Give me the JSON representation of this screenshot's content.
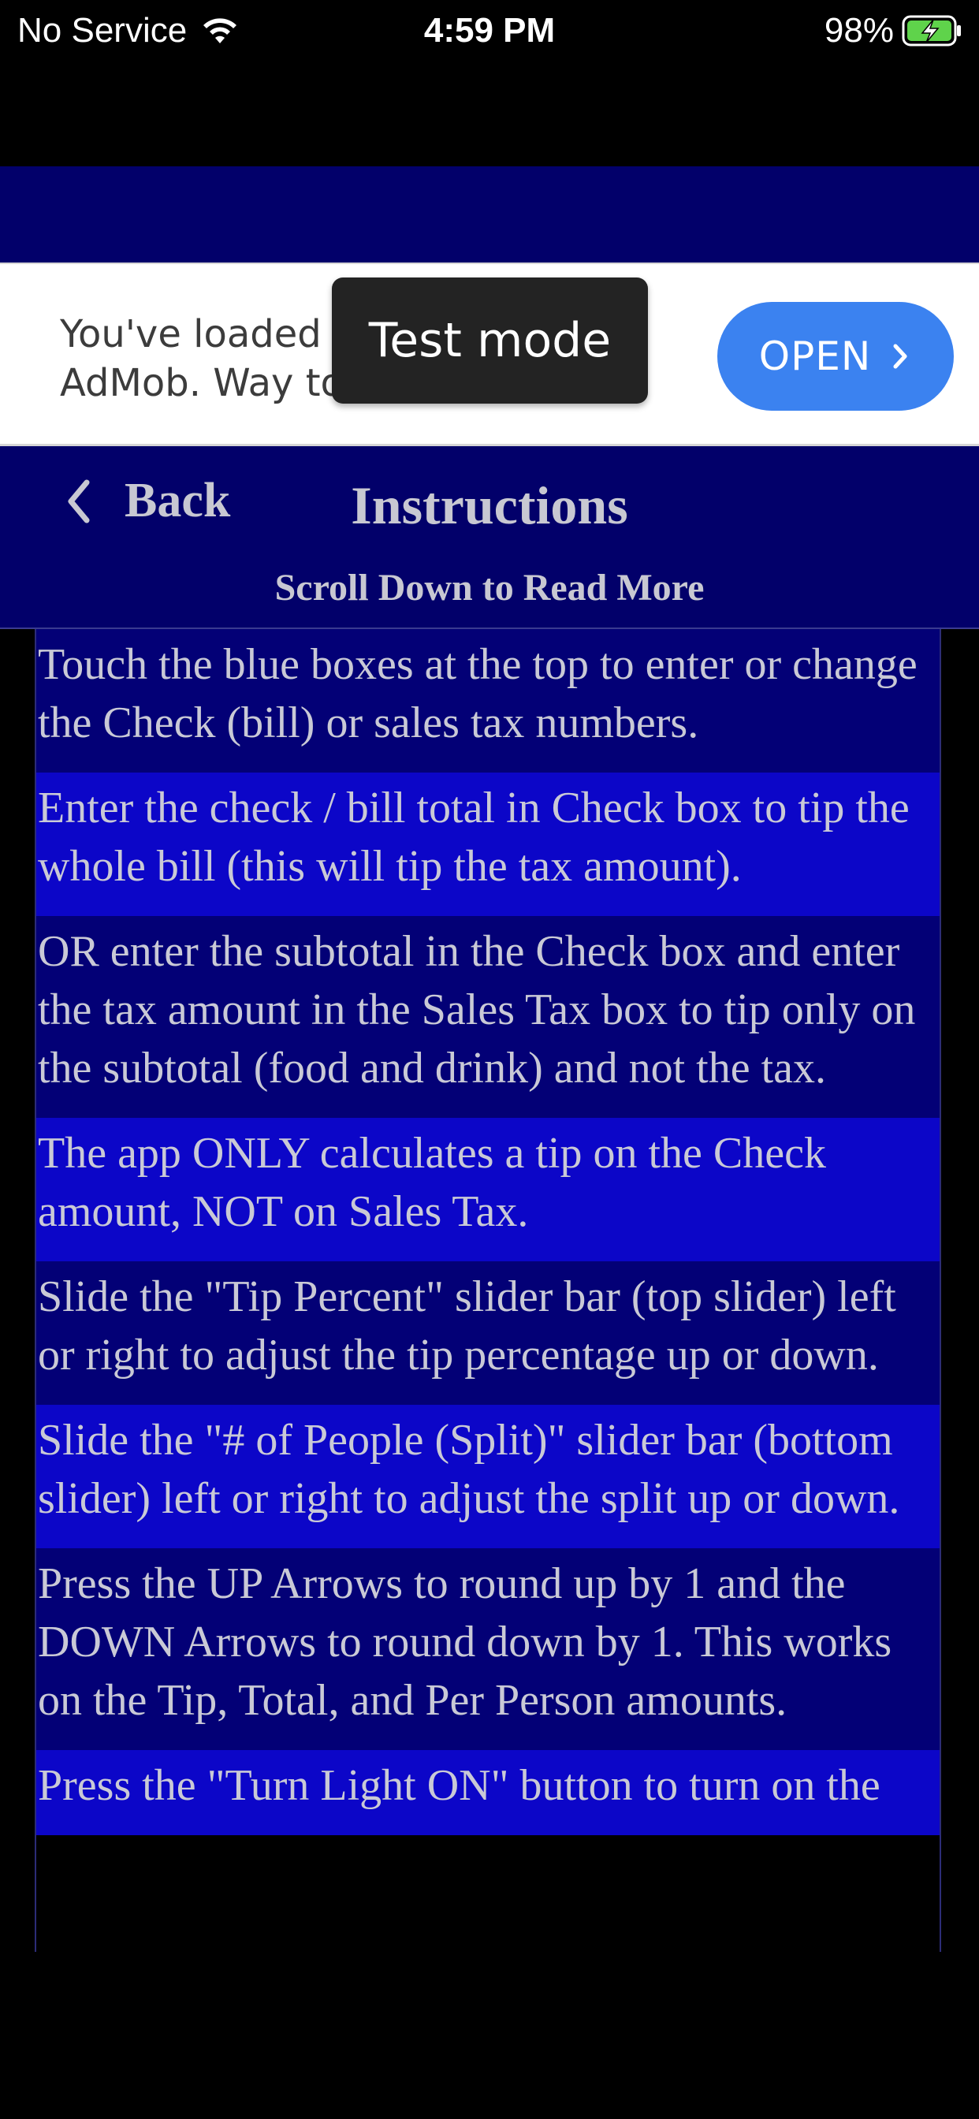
{
  "status_bar": {
    "carrier": "No Service",
    "time": "4:59 PM",
    "battery": "98%"
  },
  "ad": {
    "text_line1": "You've loaded a",
    "text_line2": "AdMob. Way to g",
    "open_label": "OPEN",
    "test_mode_label": "Test mode",
    "button_color": "#3b82f0"
  },
  "header": {
    "back_label": "Back",
    "title": "Instructions",
    "scroll_hint": "Scroll Down to Read More"
  },
  "colors": {
    "nav_background": "#02006a",
    "row_dark": "#030076",
    "row_light": "#0c06c8",
    "text": "#c9c9d6"
  },
  "instructions": [
    "Touch the blue boxes at the top to enter or change the Check (bill) or sales tax numbers.",
    "Enter the check / bill total in Check box to tip the whole bill (this will tip the tax amount).",
    "OR enter the subtotal in the Check box and enter the tax amount in the Sales Tax box to tip only on the subtotal (food and drink) and not the tax.",
    "The app ONLY calculates a tip on the Check amount, NOT on Sales Tax.",
    "Slide the \"Tip Percent\" slider bar (top slider) left or right to adjust the tip percentage up or down.",
    "Slide the \"# of People (Split)\" slider bar (bottom slider) left or right to adjust the split up or down.",
    "Press the UP Arrows to round up by 1 and the DOWN Arrows to round down by 1. This works on the Tip, Total, and Per Person amounts.",
    "Press the \"Turn Light ON\" button to turn on the"
  ]
}
